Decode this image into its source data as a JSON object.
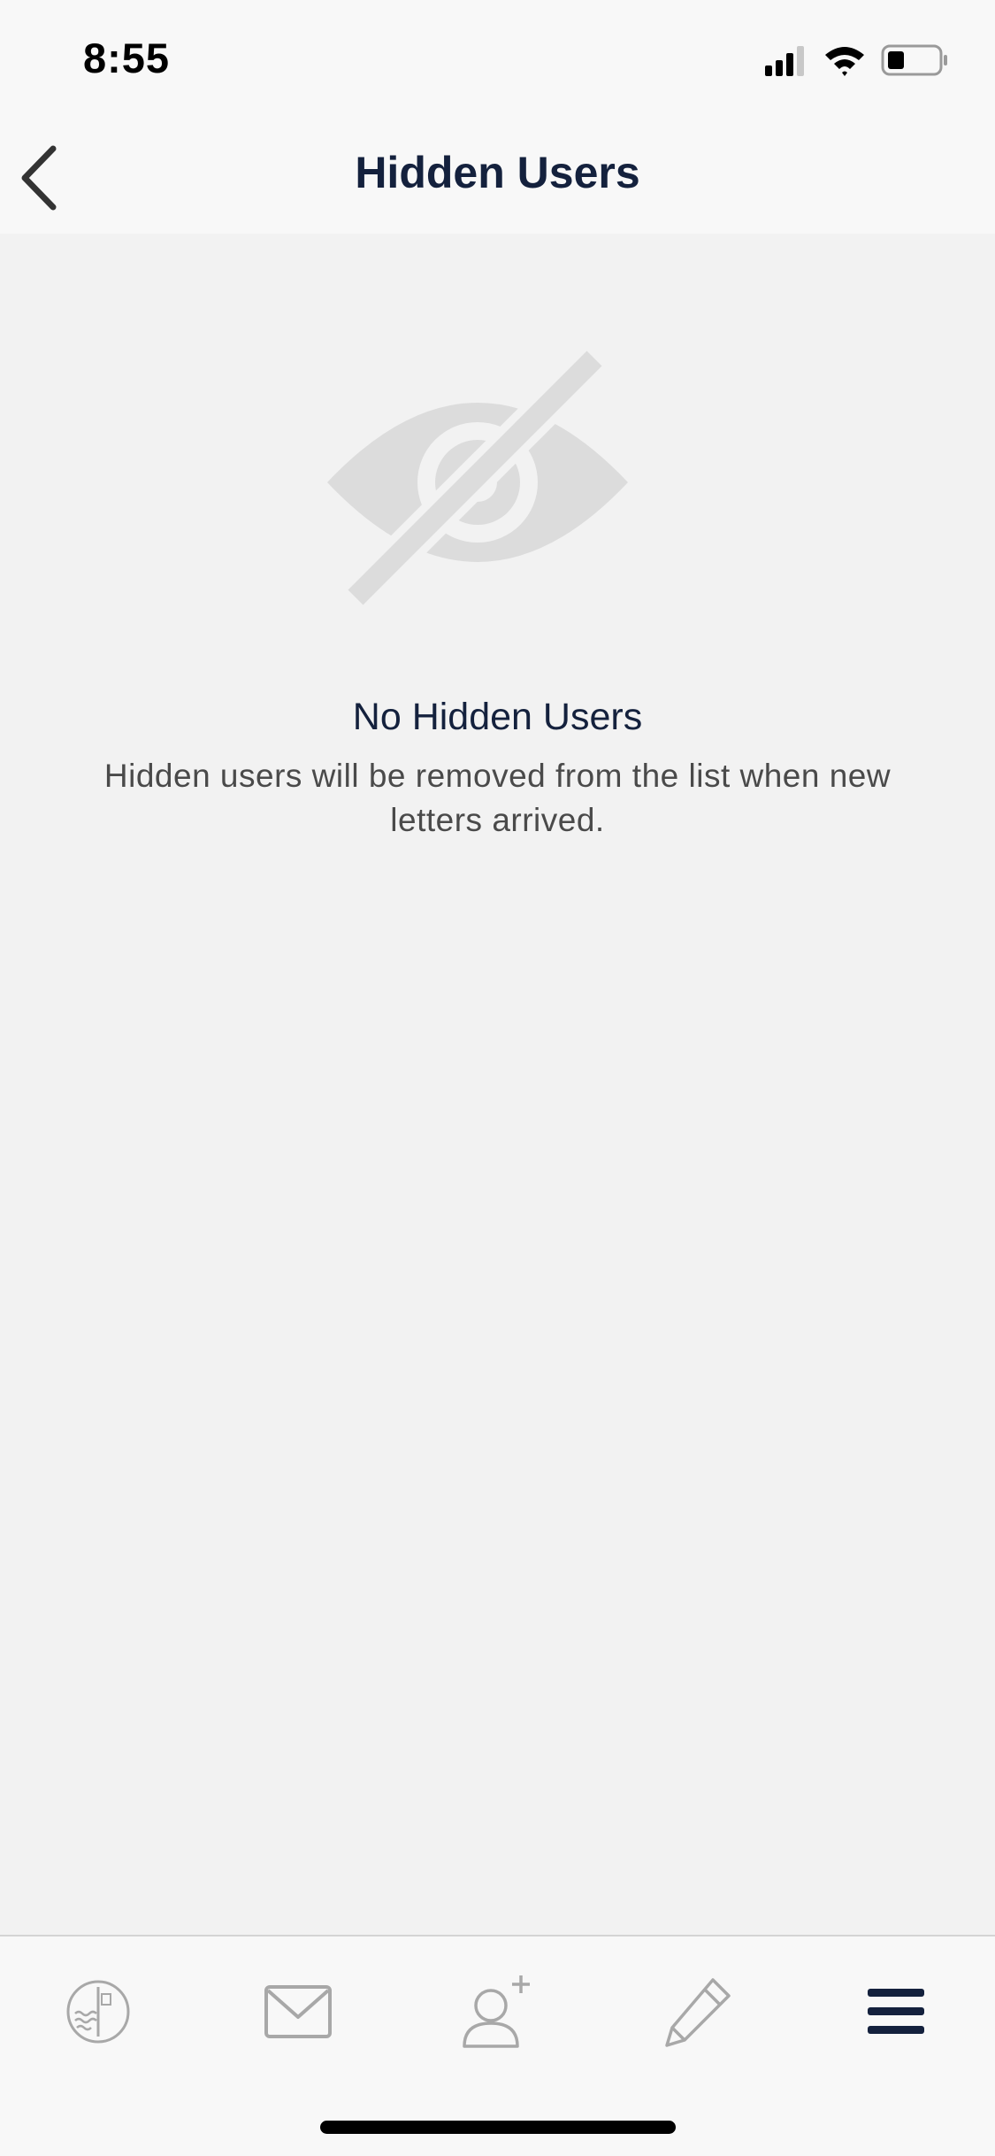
{
  "status_bar": {
    "time": "8:55"
  },
  "nav": {
    "title": "Hidden Users",
    "back_icon": "chevron-left-icon"
  },
  "empty_state": {
    "icon": "eye-slash-icon",
    "title": "No Hidden Users",
    "description": "Hidden users will be removed from the list when new letters arrived."
  },
  "tab_bar": {
    "items": [
      {
        "icon": "stamp-icon",
        "active": false
      },
      {
        "icon": "envelope-icon",
        "active": false
      },
      {
        "icon": "add-user-icon",
        "active": false
      },
      {
        "icon": "pencil-icon",
        "active": false
      },
      {
        "icon": "menu-icon",
        "active": true
      }
    ]
  },
  "colors": {
    "navy": "#14213d",
    "icon_gray": "#a8a8a8",
    "background": "#f2f2f2",
    "bar_background": "#f8f8f8"
  }
}
